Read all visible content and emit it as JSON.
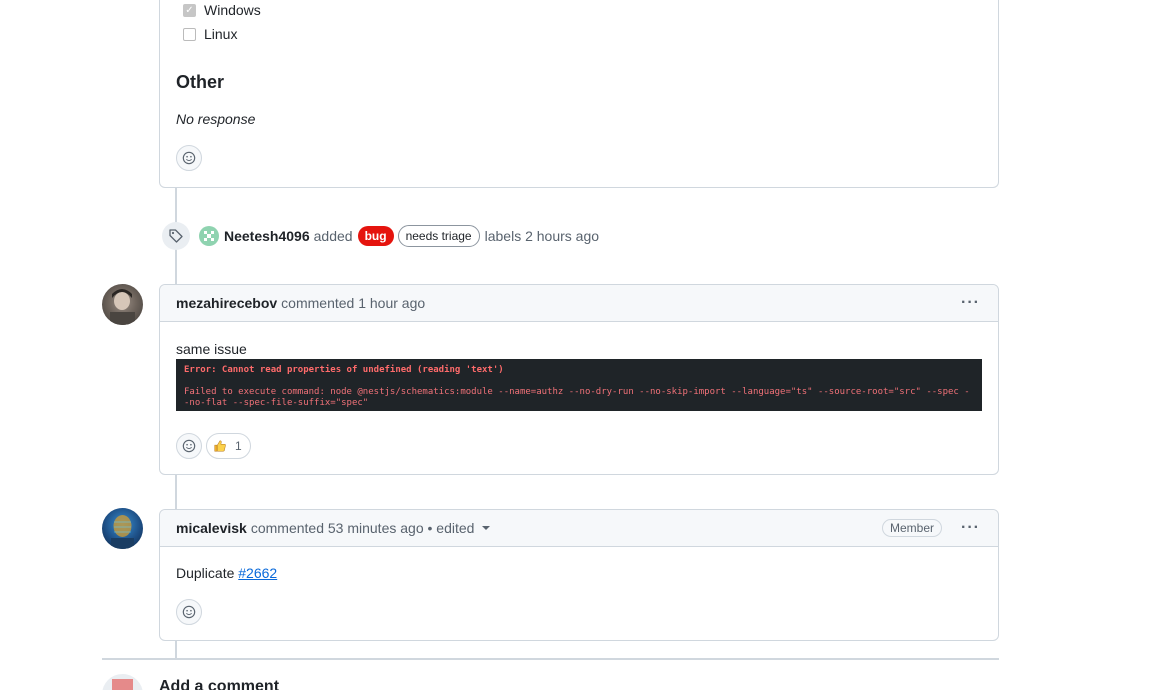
{
  "top_box": {
    "options": [
      {
        "label": "Windows",
        "checked": true
      },
      {
        "label": "Linux",
        "checked": false
      }
    ],
    "section_title": "Other",
    "section_value": "No response"
  },
  "event": {
    "actor": "Neetesh4096",
    "action": "added",
    "labels": [
      {
        "name": "bug",
        "bg": "#e5140e",
        "fg": "#ffffff"
      },
      {
        "name": "needs triage",
        "bg": "#ffffff",
        "fg": "#1f2328"
      }
    ],
    "suffix": "labels 2 hours ago"
  },
  "comments": [
    {
      "author": "mezahirecebov",
      "meta": "commented 1 hour ago",
      "body_text": "same issue",
      "code_line1": "Error: Cannot read properties of undefined (reading 'text')",
      "code_line2": "Failed to execute command: node @nestjs/schematics:module --name=authz --no-dry-run --no-skip-import --language=\"ts\" --source-root=\"src\" --spec --no-flat --spec-file-suffix=\"spec\"",
      "reaction_count": "1"
    },
    {
      "author": "micalevisk",
      "meta": "commented 53 minutes ago • edited",
      "badge": "Member",
      "body_prefix": "Duplicate ",
      "body_link": "#2662"
    }
  ],
  "add_comment": "Add a comment",
  "colors": {
    "accent": "#0969da",
    "border": "#d0d7de",
    "bug": "#e5140e"
  }
}
